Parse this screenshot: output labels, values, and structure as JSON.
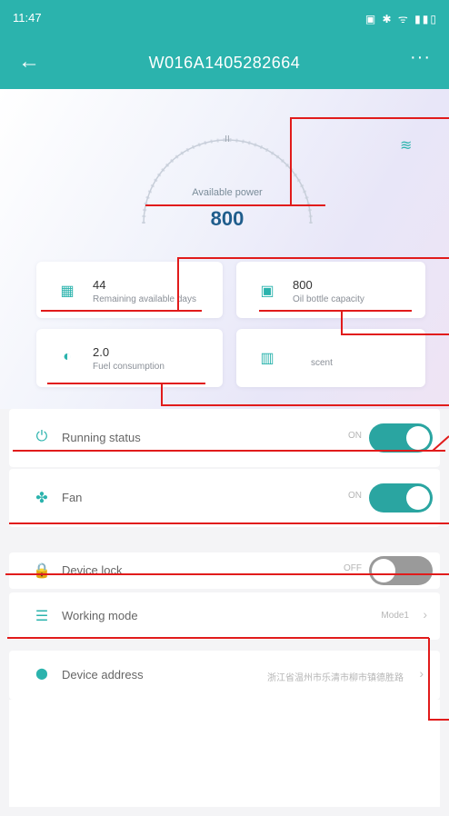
{
  "status_bar": {
    "time": "11:47",
    "icons": "▣ ✱ ᯤ ▮▮▯"
  },
  "app_bar": {
    "back_glyph": "←",
    "title": "W016A1405282664",
    "more_glyph": "···"
  },
  "gauge": {
    "label": "Available power",
    "value": "800",
    "tick": "II"
  },
  "wifi_glyph": "≋",
  "cards": [
    {
      "icon": "calendar-icon",
      "glyph": "▦",
      "value": "44",
      "label": "Remaining available days"
    },
    {
      "icon": "oil-bottle-icon",
      "glyph": "▣",
      "value": "800",
      "label": "Oil bottle capacity"
    },
    {
      "icon": "fuel-drop-icon",
      "glyph": "◐",
      "value": "2.0",
      "label": "Fuel consumption"
    },
    {
      "icon": "scent-icon",
      "glyph": "▥",
      "value": "",
      "unit": "scent"
    }
  ],
  "rows": {
    "running_status": {
      "icon": "power-icon",
      "glyph": "⏻",
      "label": "Running status",
      "state": "ON",
      "on": true
    },
    "fan": {
      "icon": "fan-icon",
      "glyph": "✤",
      "label": "Fan",
      "state": "ON",
      "on": true
    },
    "device_lock": {
      "icon": "lock-icon",
      "glyph": "🔒",
      "label": "Device lock",
      "state": "OFF",
      "on": false
    },
    "working_mode": {
      "icon": "list-icon",
      "glyph": "☰",
      "label": "Working mode",
      "value": "Mode1",
      "chevron": "›"
    },
    "device_address": {
      "icon": "location-pin-icon",
      "glyph": "⬤",
      "label": "Device address",
      "value": "浙江省温州市乐清市柳市镇德胜路",
      "chevron": "›"
    }
  },
  "colors": {
    "accent": "#2bb3ad",
    "annotation": "#e11b1b",
    "toggle_on": "#2aa5a1",
    "toggle_off": "#9a9a9a"
  }
}
